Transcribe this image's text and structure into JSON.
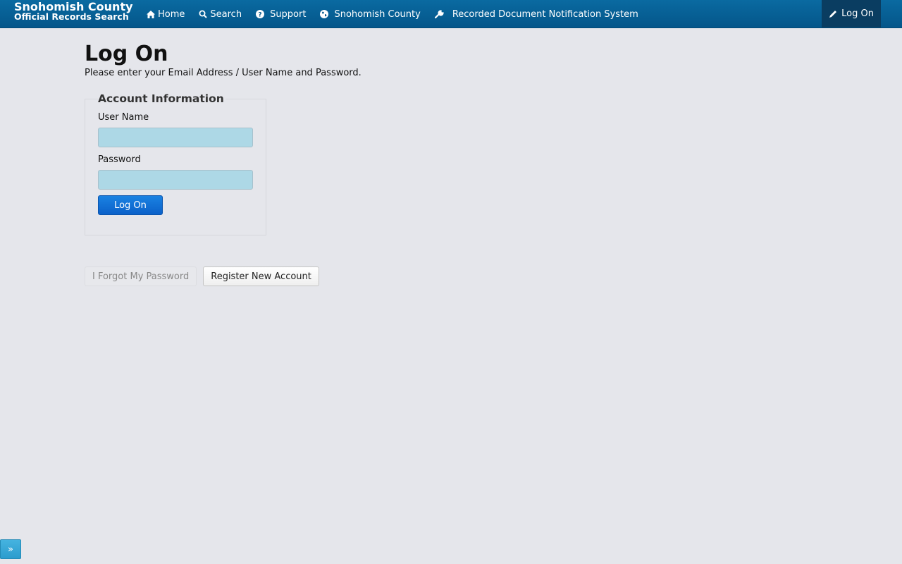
{
  "brand": {
    "line1": "Snohomish County",
    "line2": "Official Records Search"
  },
  "nav": {
    "items": [
      {
        "label": "Home",
        "icon": "home-icon"
      },
      {
        "label": "Search",
        "icon": "search-icon"
      },
      {
        "label": "Support",
        "icon": "question-circle-icon"
      },
      {
        "label": "Snohomish County",
        "icon": "globe-icon"
      },
      {
        "label": "Recorded Document Notification System",
        "icon": "wrench-icon"
      }
    ],
    "login": {
      "label": "Log On",
      "icon": "pencil-icon"
    }
  },
  "page": {
    "title": "Log On",
    "subtitle": "Please enter your Email Address / User Name and Password."
  },
  "form": {
    "legend": "Account Information",
    "username_label": "User Name",
    "username_value": "",
    "password_label": "Password",
    "password_value": "",
    "submit_label": "Log On"
  },
  "actions": {
    "forgot_label": "I Forgot My Password",
    "register_label": "Register New Account"
  },
  "expander": {
    "label": "»"
  },
  "colors": {
    "navbar": "#0a6aa1",
    "input_bg": "#add8e6",
    "primary": "#1a82e2",
    "page_bg": "#e5e6eb"
  }
}
